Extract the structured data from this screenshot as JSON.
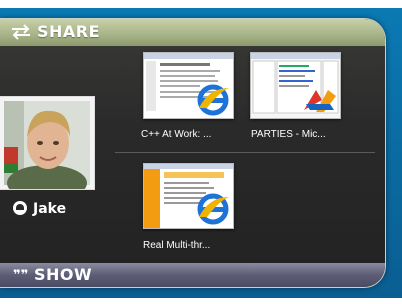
{
  "share": {
    "title": "SHARE",
    "icon": "share-arrows-icon"
  },
  "show": {
    "title": "SHOW",
    "icon": "quote-icon",
    "icon_text": "❞❞"
  },
  "contact": {
    "name": "Jake",
    "status_icon": "person-status-icon"
  },
  "thumbnails": [
    {
      "label": "C++ At Work: ...",
      "app_icon": "internet-explorer-icon"
    },
    {
      "label": "PARTIES - Mic...",
      "app_icon": "visual-studio-icon"
    },
    {
      "label": "Real Multi-thr...",
      "app_icon": "internet-explorer-icon"
    }
  ],
  "colors": {
    "share_bar": "#a9b58a",
    "show_bar": "#5d5d76",
    "panel": "#2a2a2a",
    "desktop": "#0a6aa0"
  }
}
